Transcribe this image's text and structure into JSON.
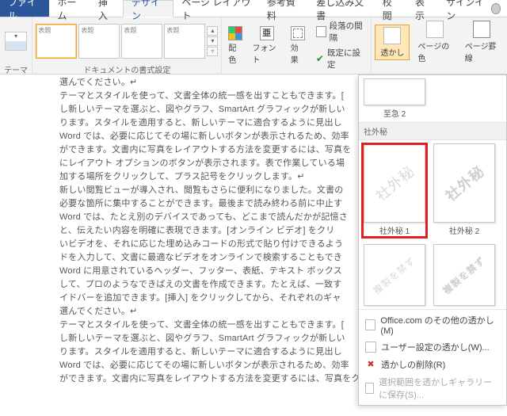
{
  "tabs": {
    "file": "ファイル",
    "home": "ホーム",
    "insert": "挿入",
    "design": "デザイン",
    "layout": "ページ レイアウト",
    "references": "参考資料",
    "mailings": "差し込み文書",
    "review": "校閲",
    "view": "表示",
    "signin": "サインイン"
  },
  "ribbon": {
    "themes_label": "テーマ",
    "doc_format_label": "ドキュメントの書式設定",
    "colors": "配色",
    "fonts": "フォント",
    "font_glyph": "亜",
    "effects": "効果",
    "para_spacing": "段落の間隔",
    "set_default": "既定に設定",
    "watermark": "透かし",
    "page_color": "ページの色",
    "page_borders": "ページ罫線",
    "gal": [
      "表題",
      "表題",
      "表題",
      "表題"
    ]
  },
  "wm": {
    "urgent_cap": "至急 2",
    "section": "社外秘",
    "item1_text": "社外秘",
    "item1_cap": "社外秘 1",
    "item2_text": "社外秘",
    "item2_cap": "社外秘 2",
    "item3_text": "複製を禁ず",
    "menu": {
      "office": "Office.com のその他の透かし(M)",
      "custom": "ユーザー設定の透かし(W)...",
      "remove": "透かしの削除(R)",
      "save": "選択範囲を透かしギャラリーに保存(S)..."
    }
  },
  "doc": {
    "l1": "選んでください。↵",
    "l2": "テーマとスタイルを使って、文書全体の統一感を出すこともできます。[",
    "l3": "し新しいテーマを選ぶと、図やグラフ、SmartArt グラフィックが新しい",
    "l4": "ります。スタイルを適用すると、新しいテーマに適合するように見出し",
    "l5": "Word では、必要に応じてその場に新しいボタンが表示されるため、効率",
    "l6": "ができます。文書内に写真をレイアウトする方法を変更するには、写真を",
    "l7": "にレイアウト オプションのボタンが表示されます。表で作業している場",
    "l8": "加する場所をクリックして、プラス記号をクリックします。↵",
    "l9": "新しい閲覧ビューが導入され、閲覧もさらに便利になりました。文書の",
    "l10": "必要な箇所に集中することができます。最後まで読み終わる前に中止す",
    "l11": "Word では、たとえ別のデバイスであっても、どこまで読んだかが記憶さ",
    "l12": "と、伝えたい内容を明確に表現できます。[オンライン ビデオ] をクリ",
    "l13": "いビデオを、それに応じた埋め込みコードの形式で貼り付けできるよう",
    "l14": "ドを入力して、文書に最適なビデオをオンラインで検索することもでき",
    "l15": "Word に用意されているヘッダー、フッター、表紙、テキスト ボックス",
    "l16": "して、プロのようなできばえの文書を作成できます。たとえば、一致す",
    "l17": "イドバーを追加できます。[挿入] をクリックしてから、それぞれのギャ",
    "l18": "選んでください。↵",
    "l19": "テーマとスタイルを使って、文書全体の統一感を出すこともできます。[",
    "l20": "し新しいテーマを選ぶと、図やグラフ、SmartArt グラフィックが新しい",
    "l21": "ります。スタイルを適用すると、新しいテーマに適合するように見出し",
    "l22": "Word では、必要に応じてその場に新しいボタンが表示されるため、効率",
    "l23": "ができます。文書内に写真をレイアウトする方法を変更するには、写真をクリックすると"
  }
}
